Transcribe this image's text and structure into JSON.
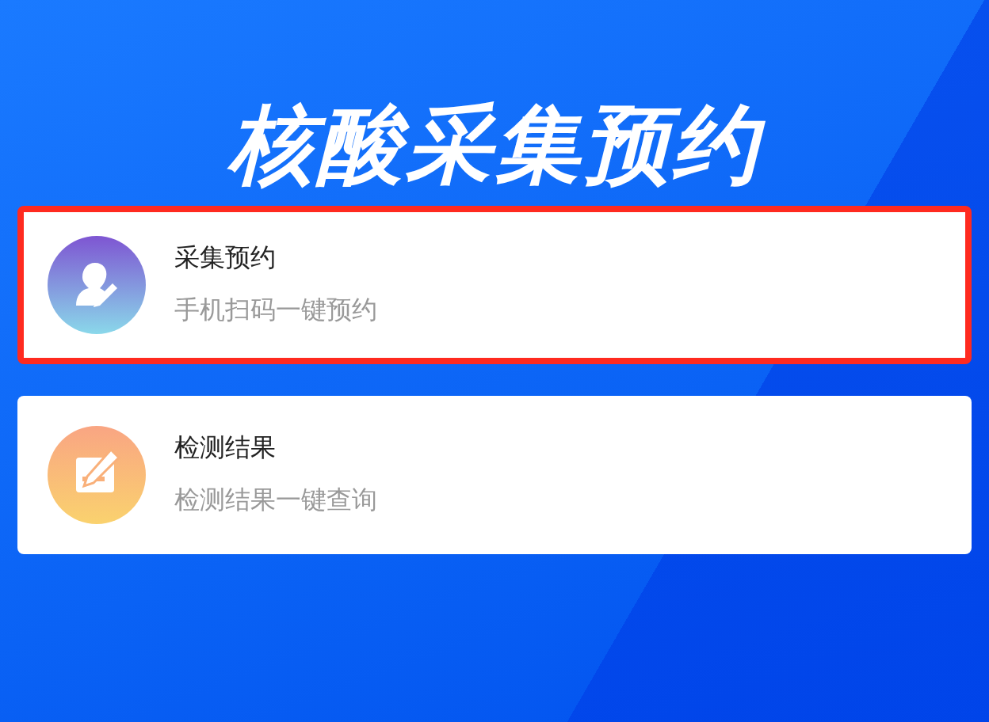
{
  "title": "核酸采集预约",
  "cards": [
    {
      "kind": "appointment",
      "title": "采集预约",
      "subtitle": "手机扫码一键预约",
      "highlighted": true
    },
    {
      "kind": "result",
      "title": "检测结果",
      "subtitle": "检测结果一键查询",
      "highlighted": false
    }
  ]
}
